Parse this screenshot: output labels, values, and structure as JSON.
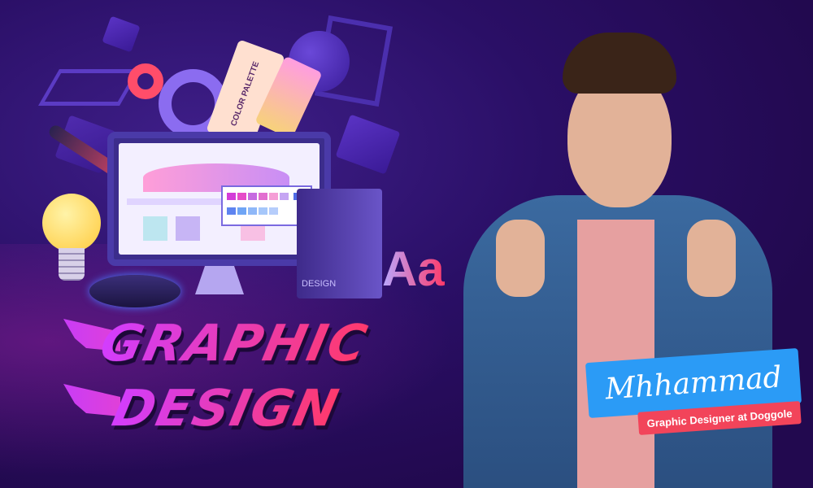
{
  "headline": {
    "line1": "GRAPHIC",
    "line2": "DESIGN"
  },
  "illustration": {
    "palette_label": "COLOR PALETTE",
    "book_label": "DESIGN",
    "typography_sample": "Aa"
  },
  "name_card": {
    "name": "Mhhammad",
    "role": "Graphic Designer at Doggole"
  },
  "colors": {
    "background": "#22094f",
    "name_card": "#2b9bf6",
    "role_badge": "#f2445a",
    "title_start": "#d23dff",
    "title_end": "#ff3a6a"
  }
}
